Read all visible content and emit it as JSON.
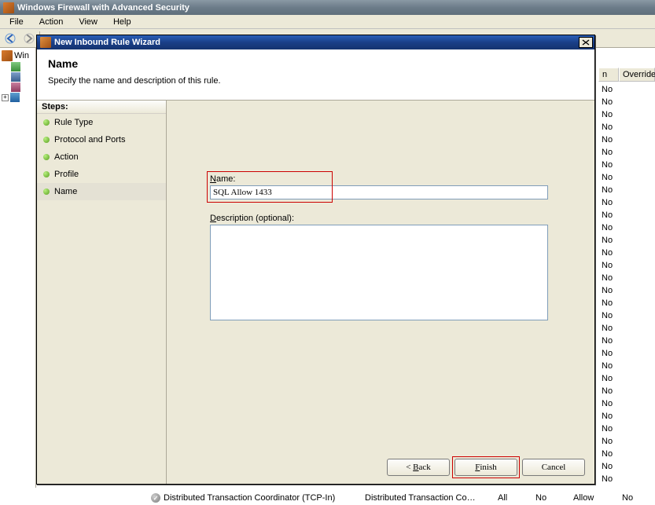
{
  "app": {
    "title": "Windows Firewall with Advanced Security"
  },
  "menu": {
    "items": [
      "File",
      "Action",
      "View",
      "Help"
    ]
  },
  "tree": {
    "root_abbrev": "Win"
  },
  "bg_columns": {
    "col1_header": "n",
    "col2_header": "Override",
    "col1_values": [
      "No",
      "No",
      "No",
      "No",
      "No",
      "No",
      "No",
      "No",
      "No",
      "No",
      "No",
      "No",
      "No",
      "No",
      "No",
      "No",
      "No",
      "No",
      "No",
      "No",
      "No",
      "No",
      "No",
      "No",
      "No",
      "No",
      "No",
      "No",
      "No",
      "No",
      "No",
      "No"
    ],
    "col2_value_last": "No"
  },
  "wizard": {
    "title": "New Inbound Rule Wizard",
    "header_title": "Name",
    "header_desc": "Specify the name and description of this rule.",
    "steps_label": "Steps:",
    "steps": [
      {
        "label": "Rule Type"
      },
      {
        "label": "Protocol and Ports"
      },
      {
        "label": "Action"
      },
      {
        "label": "Profile"
      },
      {
        "label": "Name"
      }
    ],
    "name_label_pre": "N",
    "name_label_rest": "ame:",
    "name_value": "SQL Allow 1433",
    "desc_label_pre": "D",
    "desc_label_rest": "escription (optional):",
    "desc_value": "",
    "buttons": {
      "back": "< Back",
      "finish": "Finish",
      "cancel": "Cancel"
    }
  },
  "grid": {
    "rows": [
      {
        "name": "Distributed Transaction Coordinator (TCP-In)",
        "group": "Distributed Transaction Coordi…",
        "profile": "All",
        "enabled": "No",
        "action": "Allow",
        "override": "No"
      }
    ]
  }
}
